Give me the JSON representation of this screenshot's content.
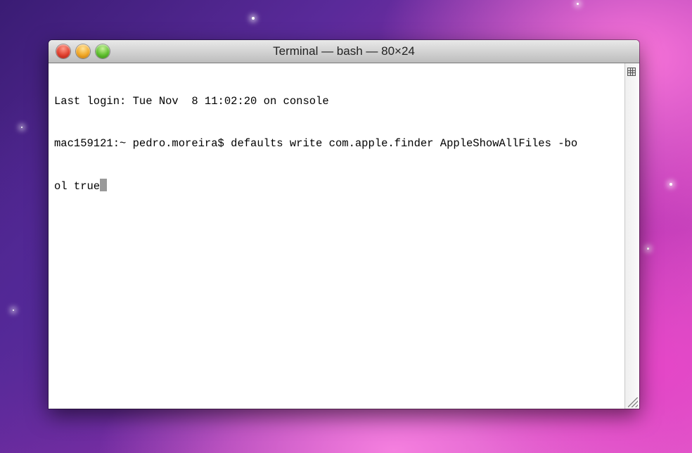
{
  "window": {
    "title": "Terminal — bash — 80×24"
  },
  "terminal": {
    "lines": [
      "Last login: Tue Nov  8 11:02:20 on console",
      "mac159121:~ pedro.moreira$ defaults write com.apple.finder AppleShowAllFiles -bo",
      "ol true"
    ]
  },
  "icons": {
    "close": "close-traffic-light",
    "minimize": "minimize-traffic-light",
    "zoom": "zoom-traffic-light",
    "split": "split-pane-icon",
    "resize": "resize-grip-icon"
  },
  "colors": {
    "close": "#e0412f",
    "minimize": "#f0a828",
    "zoom": "#5fbf2f"
  }
}
